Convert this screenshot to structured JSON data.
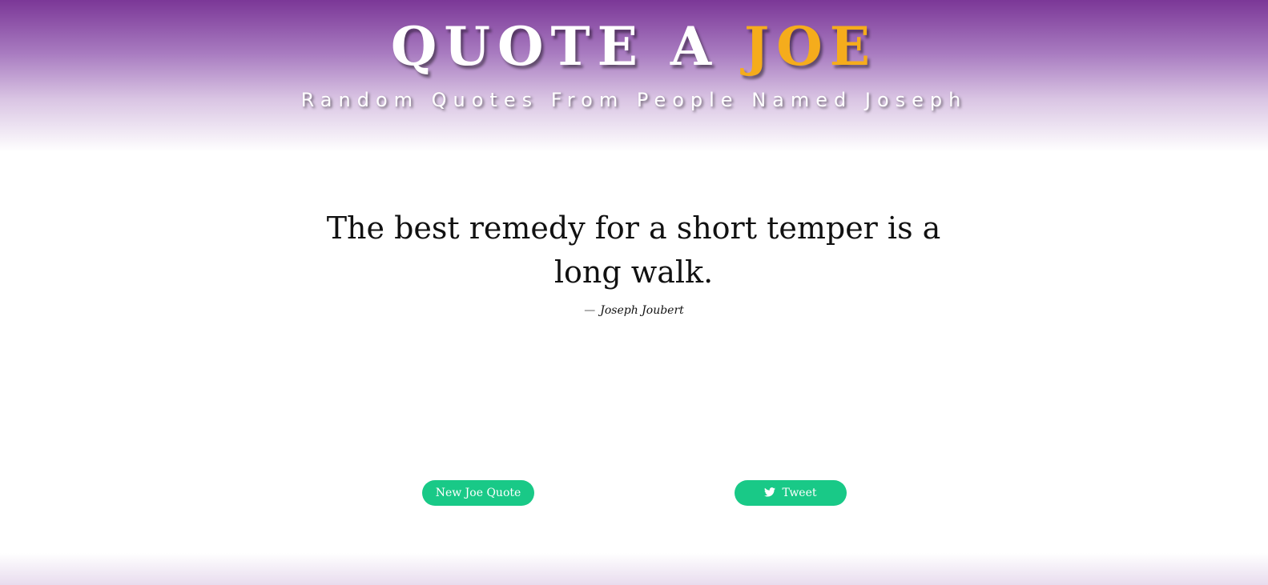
{
  "header": {
    "title_main": "QUOTE A ",
    "title_accent": "JOE",
    "subtitle": "Random Quotes From People Named Joseph"
  },
  "quote": {
    "text": "The best remedy for a short temper is a long walk.",
    "dash": "—",
    "author": "Joseph Joubert"
  },
  "buttons": {
    "new_quote_label": "New Joe Quote",
    "tweet_label": "Tweet",
    "tweet_icon": "twitter-bird-icon"
  },
  "colors": {
    "header_top": "#7b3797",
    "accent": "#f5ac1c",
    "button": "#19c987"
  }
}
